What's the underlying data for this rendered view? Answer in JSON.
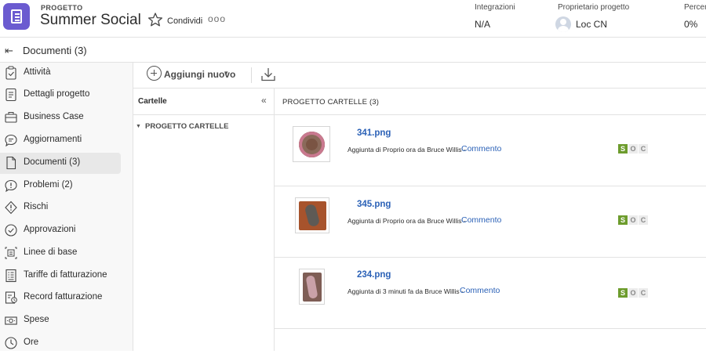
{
  "header": {
    "project_label": "PROGETTO",
    "project_title": "Summer Social",
    "share_label": "Condividi",
    "more_label": "ooo",
    "integrations_label": "Integrazioni",
    "integrations_value": "N/A",
    "owner_label": "Proprietario progetto",
    "owner_value": "Loc CN",
    "percent_label": "Percen",
    "percent_value": "0%"
  },
  "subheader": {
    "title": "Documenti (3)"
  },
  "sidebar": {
    "items": [
      {
        "label": "Attività",
        "icon": "clipboard-check-icon",
        "active": false
      },
      {
        "label": "Dettagli progetto",
        "icon": "document-lines-icon",
        "active": false
      },
      {
        "label": "Business Case",
        "icon": "briefcase-icon",
        "active": false
      },
      {
        "label": "Aggiornamenti",
        "icon": "speech-bubble-icon",
        "active": false
      },
      {
        "label": "Documenti (3)",
        "icon": "document-icon",
        "active": true
      },
      {
        "label": "Problemi (2)",
        "icon": "alert-bubble-icon",
        "active": false
      },
      {
        "label": "Rischi",
        "icon": "diamond-alert-icon",
        "active": false
      },
      {
        "label": "Approvazioni",
        "icon": "check-circle-icon",
        "active": false
      },
      {
        "label": "Linee di base",
        "icon": "baseline-icon",
        "active": false
      },
      {
        "label": "Tariffe di fatturazione",
        "icon": "rates-list-icon",
        "active": false
      },
      {
        "label": "Record fatturazione",
        "icon": "billing-record-icon",
        "active": false
      },
      {
        "label": "Spese",
        "icon": "money-icon",
        "active": false
      },
      {
        "label": "Ore",
        "icon": "clock-icon",
        "active": false
      }
    ]
  },
  "toolbar": {
    "add_label": "Aggiungi nuovo",
    "add_chevron": "▾"
  },
  "folders": {
    "title": "Cartelle",
    "collapse_icon": "«",
    "tree_item": "PROGETTO CARTELLE"
  },
  "documents": {
    "title": "PROGETTO CARTELLE (3)",
    "items": [
      {
        "name": "341.png",
        "info": "Aggiunta di Proprio ora da Bruce Willis -",
        "comment": "Commento",
        "soc": [
          "S",
          "O",
          "C"
        ],
        "thumb_color": "#7a5443"
      },
      {
        "name": "345.png",
        "info": "Aggiunta di Proprio ora da Bruce Willis -",
        "comment": "Commento",
        "soc": [
          "S",
          "O",
          "C"
        ],
        "thumb_color": "#a7532c"
      },
      {
        "name": "234.png",
        "info": "Aggiunta di 3 minuti fa da Bruce Willis -",
        "comment": "Commento",
        "soc": [
          "S",
          "O",
          "C"
        ],
        "thumb_color": "#7e5d55"
      }
    ]
  },
  "colors": {
    "brand_purple": "#6b5bd0",
    "link_blue": "#2c62b7",
    "status_green": "#6d9c2d"
  }
}
